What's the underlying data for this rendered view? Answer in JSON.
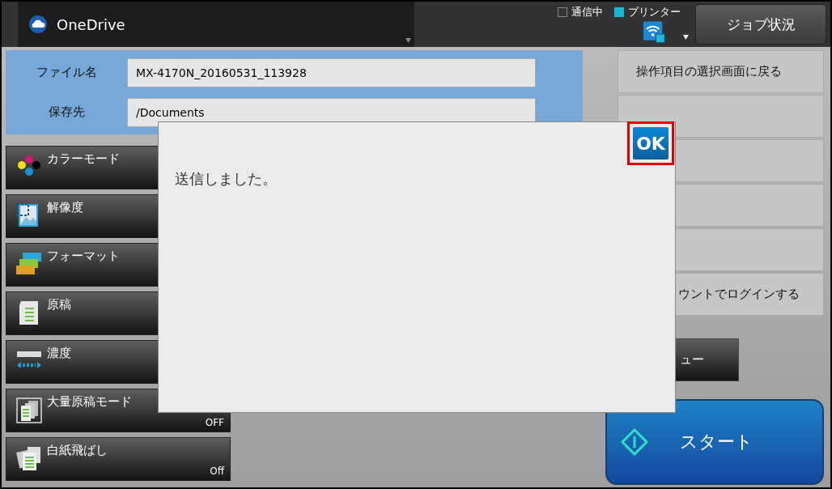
{
  "header": {
    "app": {
      "label": "OneDrive"
    },
    "status": [
      {
        "label": "通信中",
        "on": false
      },
      {
        "label": "プリンター",
        "on": true
      }
    ],
    "job_status_button": "ジョブ状況"
  },
  "destination": {
    "fields": [
      {
        "label": "ファイル名",
        "value": "MX-4170N_20160531_113928"
      },
      {
        "label": "保存先",
        "value": "/Documents"
      }
    ]
  },
  "settings": [
    {
      "label": "カラーモード",
      "kind": "color"
    },
    {
      "label": "解像度",
      "kind": "resolution"
    },
    {
      "label": "フォーマット",
      "kind": "format"
    },
    {
      "label": "原稿",
      "kind": "document"
    },
    {
      "label": "濃度",
      "kind": "density"
    },
    {
      "label": "大量原稿モード",
      "value": "OFF",
      "kind": "stack"
    },
    {
      "label": "白紙飛ばし",
      "value": "Off",
      "kind": "pages"
    }
  ],
  "side_menu": [
    {
      "kind": "text",
      "label": "操作項目の選択画面に戻る"
    },
    {
      "kind": "blank"
    },
    {
      "kind": "blank"
    },
    {
      "kind": "blank"
    },
    {
      "kind": "blank"
    },
    {
      "kind": "cut",
      "label": "ウントでログインする"
    }
  ],
  "preview_button": "ュー",
  "start_button": "スタート",
  "dialog": {
    "message": "送信しました。",
    "ok_button": {
      "label": "OK",
      "highlighted": true
    }
  }
}
